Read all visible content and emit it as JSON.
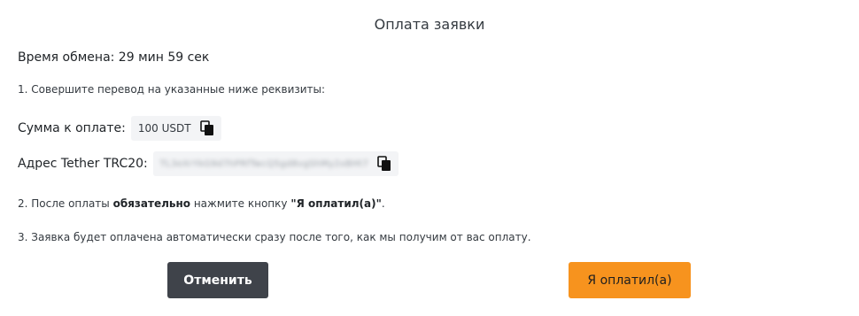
{
  "modal": {
    "title": "Оплата заявки"
  },
  "timer": {
    "text": "Время обмена: 29 мин 59 сек"
  },
  "steps": {
    "step1": "1. Совершите перевод на указанные ниже реквизиты:",
    "step2_prefix": "2. После оплаты ",
    "step2_bold": "обязательно",
    "step2_middle": " нажмите кнопку ",
    "step2_button": "\"Я оплатил(а)\"",
    "step2_suffix": ".",
    "step3": "3. Заявка будет оплачена автоматически сразу после того, как мы получим от вас оплату."
  },
  "payment": {
    "amount_label": "Сумма к оплате:",
    "amount_value": "100 USDT",
    "address_label": "Адрес Tether TRC20:",
    "address_value": "TL3eXrYkG9d7hPRfTwcQ5gd8vgShMy2xBHt7"
  },
  "icons": {
    "copy": "copy-icon"
  },
  "buttons": {
    "cancel": "Отменить",
    "paid": "Я оплатил(а)"
  },
  "colors": {
    "cancel_bg": "#3f434a",
    "paid_bg": "#f7931e",
    "value_bg": "#f3f4f6"
  }
}
